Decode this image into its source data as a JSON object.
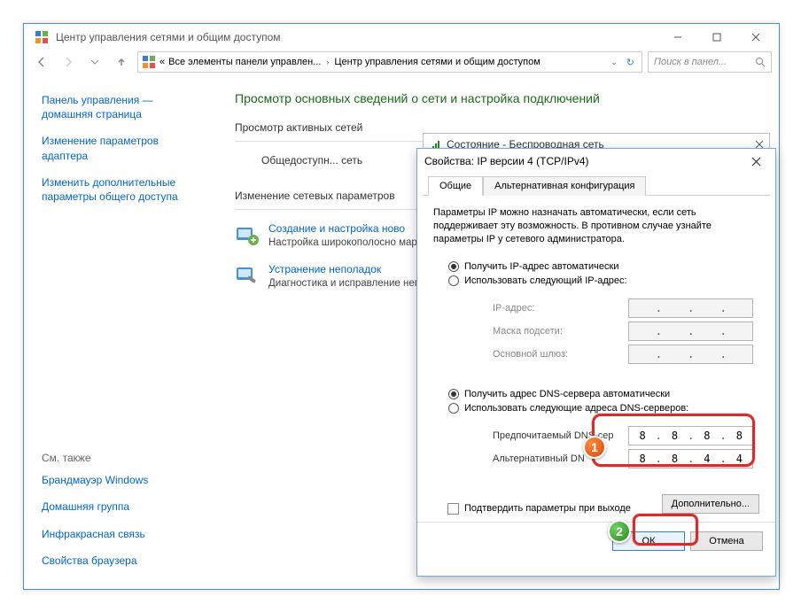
{
  "window": {
    "title": "Центр управления сетями и общим доступом",
    "addr_prefix": "«",
    "addr_seg1": "Все элементы панели управлен...",
    "addr_seg2": "Центр управления сетями и общим доступом",
    "search_placeholder": "Поиск в панел..."
  },
  "sidebar": {
    "home": "Панель управления — домашняя страница",
    "link1": "Изменение параметров адаптера",
    "link2": "Изменить дополнительные параметры общего доступа",
    "see_also_hdr": "См. также",
    "see_also": [
      "Брандмауэр Windows",
      "Домашняя группа",
      "Инфракрасная связь",
      "Свойства браузера"
    ]
  },
  "content": {
    "h1": "Просмотр основных сведений о сети и настройка подключений",
    "sec1": "Просмотр активных сетей",
    "net_name": "Общедоступн... сеть",
    "sec2": "Изменение сетевых параметров",
    "task1_title": "Создание и настройка ново",
    "task1_desc": "Настройка широкополосно маршрутизатора или точки",
    "task2_title": "Устранение неполадок",
    "task2_desc": "Диагностика и исправление неполадок."
  },
  "status_strip": "Состояние - Беспроводная сеть",
  "dialog": {
    "title": "Свойства: IP версии 4 (TCP/IPv4)",
    "tabs": [
      "Общие",
      "Альтернативная конфигурация"
    ],
    "intro": "Параметры IP можно назначать автоматически, если сеть поддерживает эту возможность. В противном случае узнайте параметры IP у сетевого администратора.",
    "ip_auto": "Получить IP-адрес автоматически",
    "ip_manual": "Использовать следующий IP-адрес:",
    "lbl_ip": "IP-адрес:",
    "lbl_mask": "Маска подсети:",
    "lbl_gw": "Основной шлюз:",
    "dns_auto": "Получить адрес DNS-сервера автоматически",
    "dns_manual": "Использовать следующие адреса DNS-серверов:",
    "lbl_dns1": "Предпочитаемый DNS-сер",
    "lbl_dns2": "Альтернативный DN",
    "dns1": [
      "8",
      "8",
      "8",
      "8"
    ],
    "dns2": [
      "8",
      "8",
      "4",
      "4"
    ],
    "confirm_on_exit": "Подтвердить параметры при выходе",
    "advanced": "Дополнительно...",
    "ok": "ОК",
    "cancel": "Отмена"
  },
  "callouts": {
    "b1": "1",
    "b2": "2"
  }
}
